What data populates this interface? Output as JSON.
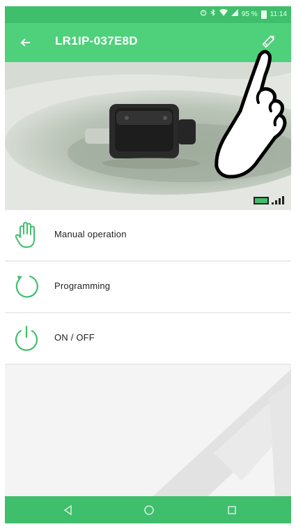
{
  "status_bar": {
    "battery_percent": "95 %",
    "time": "11:14",
    "icons": [
      "alarm-icon",
      "bluetooth-icon",
      "wifi-icon",
      "signal-icon",
      "battery-icon"
    ]
  },
  "app_bar": {
    "title": "LR1IP-037E8D",
    "back_icon": "arrow-left-icon",
    "edit_icon": "pencil-icon"
  },
  "hero": {
    "image": "irrigation-controller-photo",
    "battery_icon": "battery-icon",
    "signal_icon": "signal-strength-icon"
  },
  "menu": {
    "items": [
      {
        "label": "Manual operation",
        "icon": "hand-icon"
      },
      {
        "label": "Programming",
        "icon": "refresh-circle-icon"
      },
      {
        "label": "ON / OFF",
        "icon": "power-icon"
      }
    ]
  },
  "nav_bar": {
    "buttons": [
      "back-triangle-icon",
      "home-circle-icon",
      "recents-square-icon"
    ]
  },
  "colors": {
    "primary": "#4fd07b",
    "primary_dark": "#3fbf6b",
    "menu_background": "#ffffff",
    "page_background": "#f4f4f4",
    "icon_accent": "#3fbf6b",
    "watermark": "#e2e2e2"
  }
}
